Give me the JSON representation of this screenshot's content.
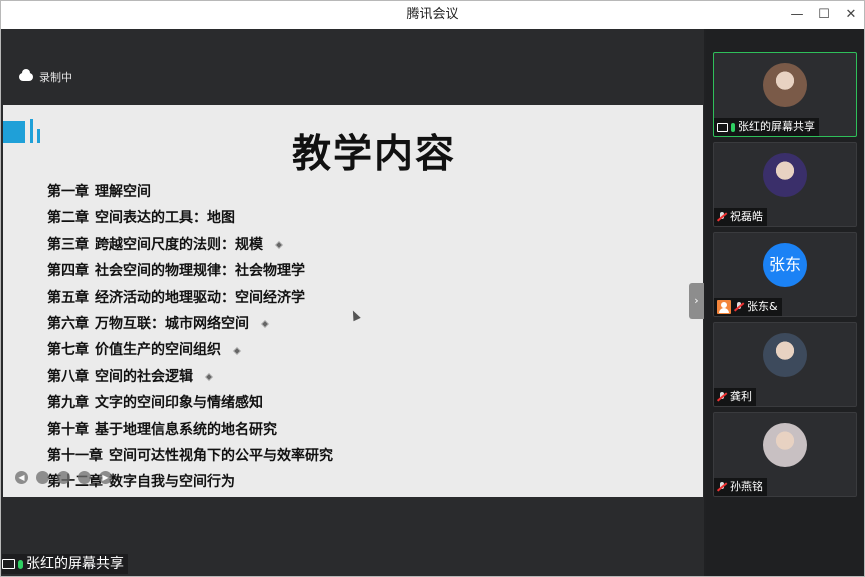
{
  "window": {
    "title": "腾讯会议",
    "minimize_glyph": "—",
    "maximize_glyph": "☐",
    "close_glyph": "✕"
  },
  "recording": {
    "icon": "cloud-icon",
    "label": "录制中"
  },
  "slide": {
    "title": "教学内容",
    "chapters": [
      {
        "no": "第一章",
        "title": "理解空间",
        "marker": false
      },
      {
        "no": "第二章",
        "title": "空间表达的工具：地图",
        "marker": false
      },
      {
        "no": "第三章",
        "title": "跨越空间尺度的法则：规模",
        "marker": true
      },
      {
        "no": "第四章",
        "title": "社会空间的物理规律：社会物理学",
        "marker": false
      },
      {
        "no": "第五章",
        "title": "经济活动的地理驱动：空间经济学",
        "marker": false
      },
      {
        "no": "第六章",
        "title": "万物互联：城市网络空间",
        "marker": true
      },
      {
        "no": "第七章",
        "title": "价值生产的空间组织",
        "marker": true
      },
      {
        "no": "第八章",
        "title": "空间的社会逻辑",
        "marker": true
      },
      {
        "no": "第九章",
        "title": "文字的空间印象与情绪感知",
        "marker": false
      },
      {
        "no": "第十章",
        "title": "基于地理信息系统的地名研究",
        "marker": false
      },
      {
        "no": "第十一章",
        "title": "空间可达性视角下的公平与效率研究",
        "marker": false
      },
      {
        "no": "第十二章",
        "title": "数字自我与空间行为",
        "marker": false
      }
    ],
    "nav_buttons": [
      "◀",
      "",
      "",
      "",
      "▶"
    ]
  },
  "collapse_handle": {
    "glyph": "›"
  },
  "share_badge": {
    "label": "张红的屏幕共享"
  },
  "participants": [
    {
      "name": "张红的屏幕共享",
      "avatar_type": "photo",
      "avatar_color": "#7a5a48",
      "mic": "on",
      "screen_share": true,
      "host": false,
      "active": true,
      "avatar_text": ""
    },
    {
      "name": "祝磊皓",
      "avatar_type": "photo",
      "avatar_color": "#3a2f6a",
      "mic": "muted",
      "screen_share": false,
      "host": false,
      "active": false,
      "avatar_text": ""
    },
    {
      "name": "张东&",
      "avatar_type": "text",
      "avatar_color": "#1b82f5",
      "mic": "muted",
      "screen_share": false,
      "host": true,
      "active": false,
      "avatar_text": "张东"
    },
    {
      "name": "龚利",
      "avatar_type": "photo",
      "avatar_color": "#3d4a5c",
      "mic": "muted",
      "screen_share": false,
      "host": false,
      "active": false,
      "avatar_text": ""
    },
    {
      "name": "孙燕铭",
      "avatar_type": "photo",
      "avatar_color": "#c8c0c2",
      "mic": "muted",
      "screen_share": false,
      "host": false,
      "active": false,
      "avatar_text": ""
    }
  ]
}
